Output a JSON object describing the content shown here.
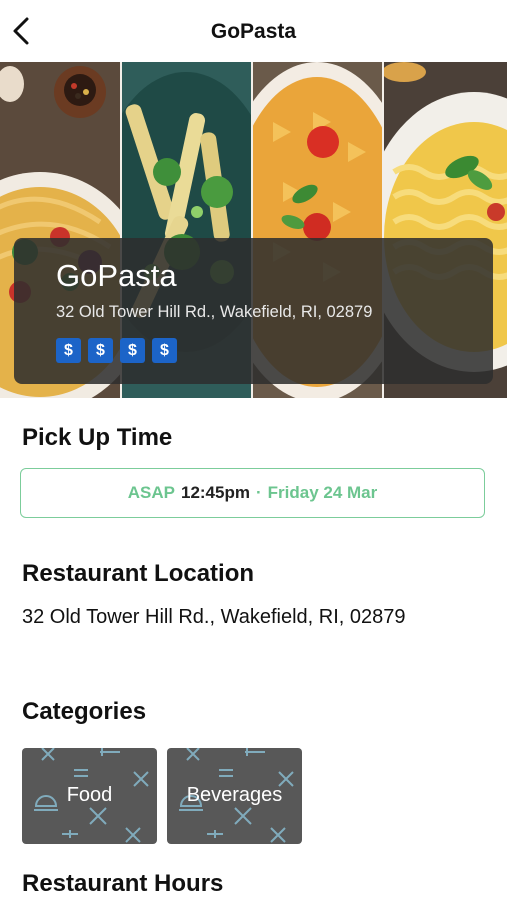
{
  "header": {
    "title": "GoPasta",
    "back_icon": "chevron-left-icon"
  },
  "restaurant": {
    "name": "GoPasta",
    "address": "32 Old Tower Hill Rd., Wakefield, RI, 02879",
    "price_symbols": [
      "$",
      "$",
      "$",
      "$"
    ],
    "price_color": "#1c64c8"
  },
  "pickup": {
    "title": "Pick Up Time",
    "asap": "ASAP",
    "time": "12:45pm",
    "separator": "·",
    "date": "Friday 24 Mar",
    "accent_color": "#6cc58f"
  },
  "location": {
    "title": "Restaurant Location",
    "address": "32 Old Tower Hill Rd., Wakefield, RI, 02879"
  },
  "categories": {
    "title": "Categories",
    "items": [
      {
        "label": "Food"
      },
      {
        "label": "Beverages"
      }
    ]
  },
  "hours": {
    "title": "Restaurant Hours"
  }
}
